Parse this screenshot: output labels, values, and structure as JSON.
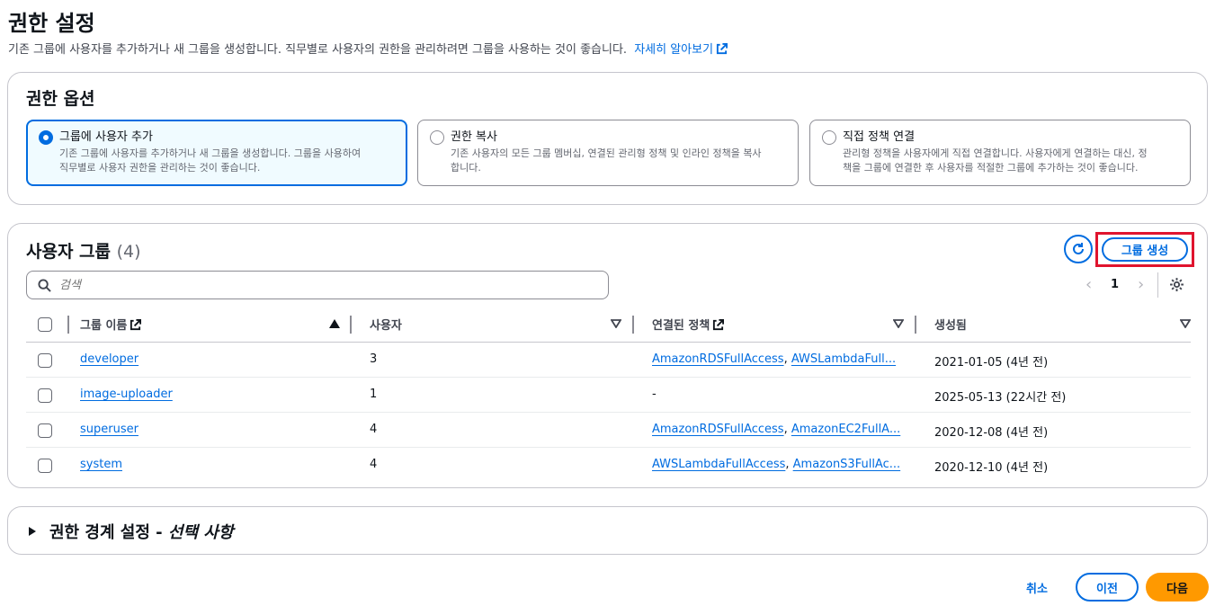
{
  "page": {
    "title": "권한 설정",
    "description": "기존 그룹에 사용자를 추가하거나 새 그룹을 생성합니다. 직무별로 사용자의 권한을 관리하려면 그룹을 사용하는 것이 좋습니다.",
    "learn_more": "자세히 알아보기"
  },
  "options": {
    "heading": "권한 옵션",
    "tiles": [
      {
        "label": "그룹에 사용자 추가",
        "desc_line1": "기존 그룹에 사용자를 추가하거나 새 그룹을 생성합니다. 그룹을 사용하여",
        "desc_line2": "직무별로 사용자 권한을 관리하는 것이 좋습니다.",
        "selected": true
      },
      {
        "label": "권한 복사",
        "desc_line1": "기존 사용자의 모든 그룹 멤버십, 연결된 관리형 정책 및 인라인 정책을 복사",
        "desc_line2": "합니다.",
        "selected": false
      },
      {
        "label": "직접 정책 연결",
        "desc_line1": "관리형 정책을 사용자에게 직접 연결합니다. 사용자에게 연결하는 대신, 정",
        "desc_line2": "책을 그룹에 연결한 후 사용자를 적절한 그룹에 추가하는 것이 좋습니다.",
        "selected": false
      }
    ]
  },
  "groups": {
    "heading": "사용자 그룹",
    "count": "(4)",
    "create_button": "그룹 생성",
    "search_placeholder": "검색",
    "page_number": "1",
    "columns": {
      "name": "그룹 이름",
      "users": "사용자",
      "policies": "연결된 정책",
      "created": "생성됨"
    },
    "rows": [
      {
        "name": "developer",
        "users": "3",
        "policy1": "AmazonRDSFullAccess",
        "policy2": "AWSLambdaFull...",
        "created": "2021-01-05 (4년 전)"
      },
      {
        "name": "image-uploader",
        "users": "1",
        "policy1": "-",
        "policy2": "",
        "created": "2025-05-13 (22시간 전)"
      },
      {
        "name": "superuser",
        "users": "4",
        "policy1": "AmazonRDSFullAccess",
        "policy2": "AmazonEC2FullA...",
        "created": "2020-12-08 (4년 전)"
      },
      {
        "name": "system",
        "users": "4",
        "policy1": "AWSLambdaFullAccess",
        "policy2": "AmazonS3FullAc...",
        "created": "2020-12-10 (4년 전)"
      }
    ]
  },
  "boundary": {
    "title": "권한 경계 설정 - ",
    "title_optional": "선택 사항"
  },
  "footer": {
    "cancel": "취소",
    "previous": "이전",
    "next": "다음"
  }
}
